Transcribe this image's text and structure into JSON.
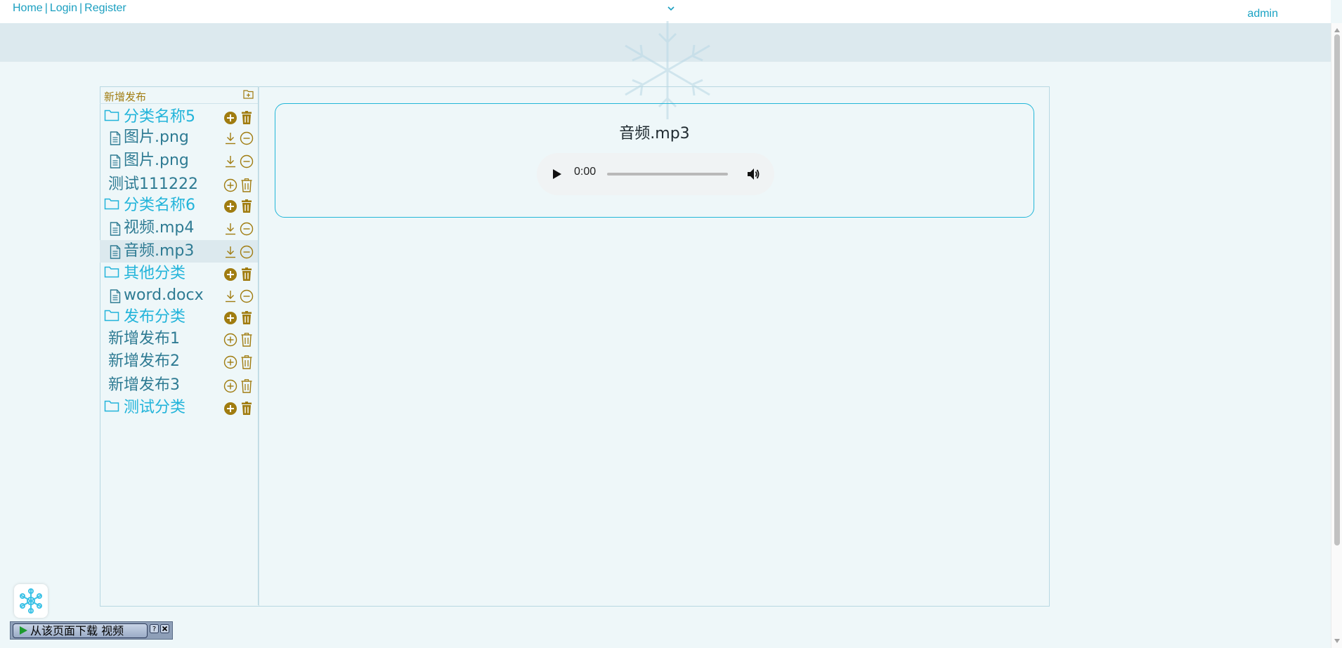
{
  "topbar": {
    "links": [
      "Home",
      "Login",
      "Register"
    ],
    "user": "admin"
  },
  "sidebar": {
    "header_label": "新增发布",
    "rows": [
      {
        "type": "category",
        "label": "分类名称5",
        "actions": [
          "add-filled-icon",
          "trash-filled-icon"
        ]
      },
      {
        "type": "file",
        "label": "图片.png",
        "actions": [
          "download-icon",
          "remove-circle-icon"
        ]
      },
      {
        "type": "file",
        "label": "图片.png",
        "actions": [
          "download-icon",
          "remove-circle-icon"
        ]
      },
      {
        "type": "item",
        "label": "测试111222",
        "actions": [
          "add-circle-icon",
          "trash-outline-icon"
        ]
      },
      {
        "type": "category",
        "label": "分类名称6",
        "actions": [
          "add-filled-icon",
          "trash-filled-icon"
        ]
      },
      {
        "type": "file",
        "label": "视频.mp4",
        "actions": [
          "download-icon",
          "remove-circle-icon"
        ]
      },
      {
        "type": "file",
        "label": "音频.mp3",
        "selected": true,
        "actions": [
          "download-icon",
          "remove-circle-icon"
        ]
      },
      {
        "type": "category",
        "label": "其他分类",
        "actions": [
          "add-filled-icon",
          "trash-filled-icon"
        ]
      },
      {
        "type": "file",
        "label": "word.docx",
        "actions": [
          "download-icon",
          "remove-circle-icon"
        ]
      },
      {
        "type": "category",
        "label": "发布分类",
        "actions": [
          "add-filled-icon",
          "trash-filled-icon"
        ]
      },
      {
        "type": "item",
        "label": "新增发布1",
        "actions": [
          "add-circle-icon",
          "trash-outline-icon"
        ]
      },
      {
        "type": "item",
        "label": "新增发布2",
        "actions": [
          "add-circle-icon",
          "trash-outline-icon"
        ]
      },
      {
        "type": "item",
        "label": "新增发布3",
        "actions": [
          "add-circle-icon",
          "trash-outline-icon"
        ]
      },
      {
        "type": "category",
        "label": "测试分类",
        "actions": [
          "add-filled-icon",
          "trash-filled-icon"
        ]
      }
    ]
  },
  "content": {
    "title": "音频.mp3",
    "player": {
      "time": "0:00",
      "progress": 0
    }
  },
  "download_widget": {
    "label": "从该页面下载 视频"
  },
  "colors": {
    "accent": "#22b4da",
    "text": "#2e7b93",
    "action_gold": "#a07c10",
    "background": "#eef7f9"
  }
}
